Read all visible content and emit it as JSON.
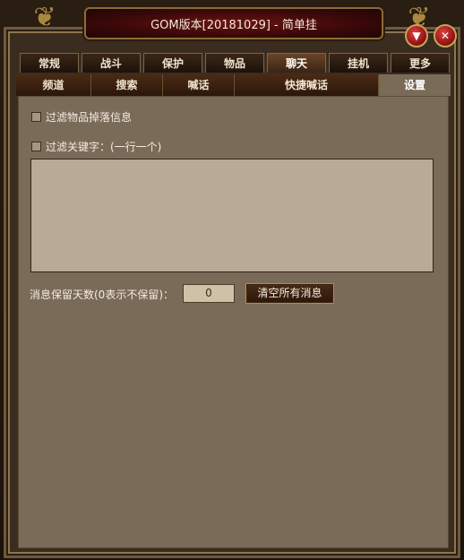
{
  "window": {
    "title": "GOM版本[20181029] - 简单挂"
  },
  "icons": {
    "dropdown": "chevron-down-icon",
    "close": "close-icon",
    "dragon": "dragon-ornament-icon"
  },
  "tabs": [
    {
      "label": "常规"
    },
    {
      "label": "战斗"
    },
    {
      "label": "保护"
    },
    {
      "label": "物品"
    },
    {
      "label": "聊天",
      "active": true
    },
    {
      "label": "挂机"
    },
    {
      "label": "更多"
    }
  ],
  "subtabs": [
    {
      "label": "频道"
    },
    {
      "label": "搜索"
    },
    {
      "label": "喊话"
    },
    {
      "label": "快捷喊话"
    },
    {
      "label": "设置",
      "active": true
    }
  ],
  "settings": {
    "filter_drop": {
      "label": "过滤物品掉落信息",
      "checked": false
    },
    "filter_keywords": {
      "label": "过滤关键字：(一行一个)",
      "checked": false
    },
    "keywords_text": "",
    "days_label": "消息保留天数(0表示不保留)：",
    "days_value": "0",
    "clear_button": "清空所有消息"
  },
  "colors": {
    "panel": "#7a6a58",
    "title_bg": "#5a1010",
    "frame": "#6e5a3c"
  }
}
